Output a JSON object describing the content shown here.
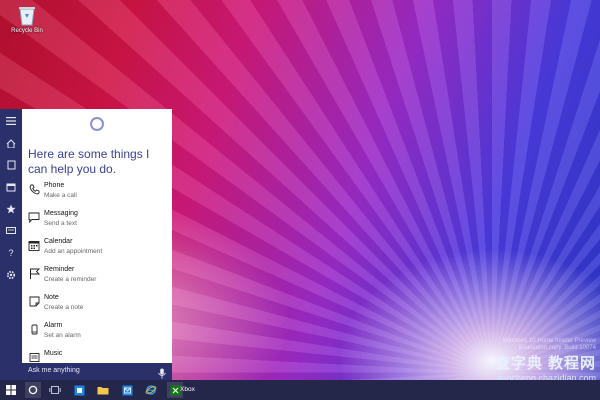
{
  "desktop": {
    "recycle_bin_label": "Recycle Bin",
    "watermark": {
      "faint_line_1": "Windows 10 Home Insider Preview",
      "faint_line_2": "Evaluation copy. Build 10074",
      "big_text": "查字典 教程网",
      "site": "jiaocheng.chazidian.com"
    }
  },
  "cortana": {
    "heading": "Here are some things I can help you do.",
    "items": [
      {
        "title": "Phone",
        "subtitle": "Make a call",
        "icon": "phone-icon"
      },
      {
        "title": "Messaging",
        "subtitle": "Send a text",
        "icon": "message-icon"
      },
      {
        "title": "Calendar",
        "subtitle": "Add an appointment",
        "icon": "calendar-icon"
      },
      {
        "title": "Reminder",
        "subtitle": "Create a reminder",
        "icon": "flag-icon"
      },
      {
        "title": "Note",
        "subtitle": "Create a note",
        "icon": "note-icon"
      },
      {
        "title": "Alarm",
        "subtitle": "Set an alarm",
        "icon": "alarm-icon"
      },
      {
        "title": "Music",
        "subtitle": "",
        "icon": "music-icon"
      }
    ],
    "ask_placeholder": "Ask me anything",
    "accent": "#3a3f91"
  },
  "rail": {
    "icons": [
      "hamburger-icon",
      "home-icon",
      "notebook-icon",
      "calendar-icon",
      "star-icon",
      "feedback-icon",
      "help-icon",
      "settings-icon"
    ]
  },
  "taskbar": {
    "xbox_label": "Xbox"
  }
}
